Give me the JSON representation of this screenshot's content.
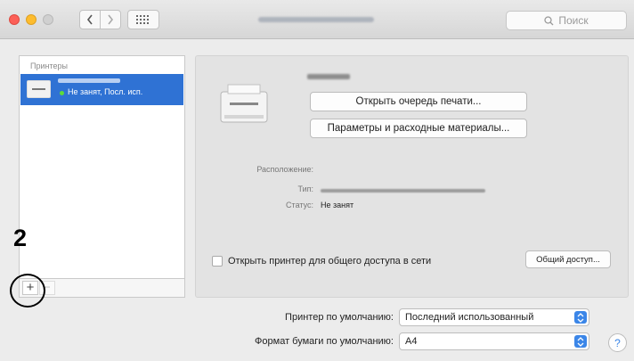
{
  "toolbar": {
    "search_placeholder": "Поиск"
  },
  "sidebar": {
    "heading": "Принтеры",
    "printers": [
      {
        "status": "Не занят, Посл. исп."
      }
    ],
    "add_label": "+",
    "remove_label": "−"
  },
  "callout": {
    "step_number": "2"
  },
  "detail": {
    "open_queue_label": "Открыть очередь печати...",
    "params_label": "Параметры и расходные материалы...",
    "location_label": "Расположение:",
    "type_label": "Тип:",
    "status_label": "Статус:",
    "status_value": "Не занят",
    "share_label": "Открыть принтер для общего доступа в сети",
    "share_button_label": "Общий доступ..."
  },
  "settings": {
    "default_printer_label": "Принтер по умолчанию:",
    "default_printer_value": "Последний использованный",
    "paper_size_label": "Формат бумаги по умолчанию:",
    "paper_size_value": "A4",
    "help_label": "?"
  },
  "colors": {
    "selection": "#2f72d4",
    "accent": "#3b86e8",
    "callout": "#000000"
  }
}
